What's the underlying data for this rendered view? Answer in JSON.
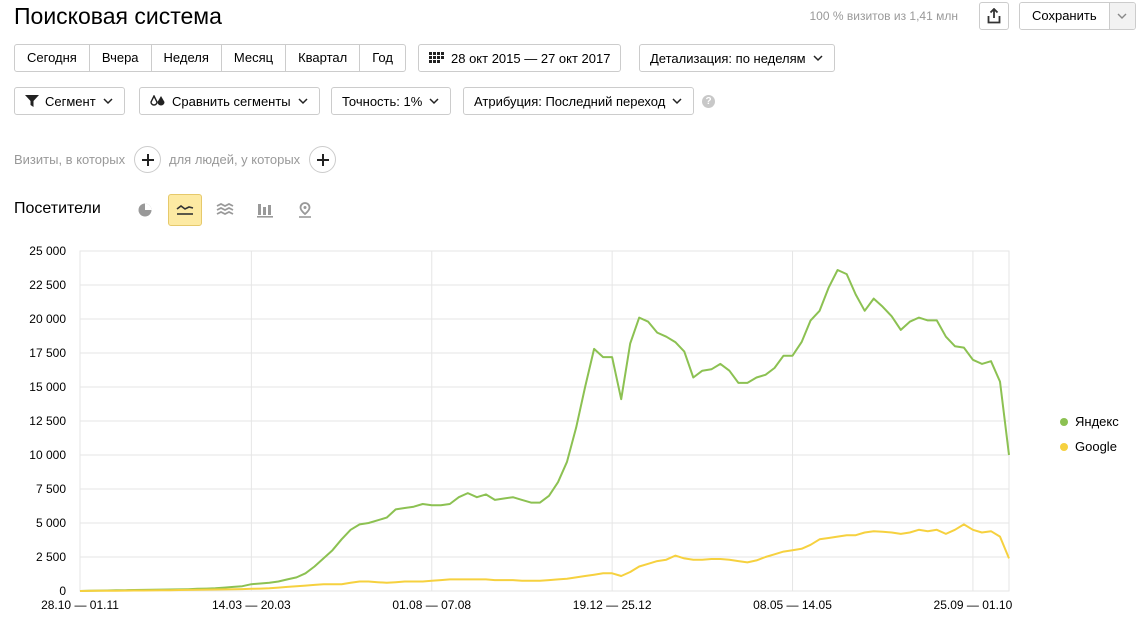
{
  "header": {
    "title": "Поисковая система",
    "visits_info": "100 % визитов из 1,41 млн",
    "save_label": "Сохранить"
  },
  "periods": [
    "Сегодня",
    "Вчера",
    "Неделя",
    "Месяц",
    "Квартал",
    "Год"
  ],
  "date_range": "28 окт 2015 — 27 окт 2017",
  "detail_label": "Детализация: по неделям",
  "segment_label": "Сегмент",
  "compare_label": "Сравнить сегменты",
  "accuracy_label": "Точность: 1%",
  "attribution_label": "Атрибуция: Последний переход",
  "help": "?",
  "filters": {
    "visits_label": "Визиты, в которых",
    "people_label": "для людей, у которых"
  },
  "metric_title": "Посетители",
  "colors": {
    "yandex": "#8cc152",
    "google": "#f6d13f",
    "grid": "#e6e6e6",
    "active_view": "#fdeaa3"
  },
  "chart_data": {
    "type": "line",
    "ylim": [
      0,
      25000
    ],
    "yticks": [
      "0",
      "2 500",
      "5 000",
      "7 500",
      "10 000",
      "12 500",
      "15 000",
      "17 500",
      "20 000",
      "22 500",
      "25 000"
    ],
    "xtick_labels": [
      "28.10 — 01.11",
      "14.03 — 20.03",
      "01.08 — 07.08",
      "19.12 — 25.12",
      "08.05 — 14.05",
      "25.09 — 01.10"
    ],
    "xtick_index": [
      0,
      19,
      39,
      59,
      79,
      99
    ],
    "series": [
      {
        "name": "Яндекс",
        "color": "#8cc152",
        "values": [
          0,
          20,
          30,
          40,
          50,
          60,
          70,
          80,
          90,
          100,
          110,
          120,
          130,
          160,
          180,
          200,
          250,
          300,
          350,
          500,
          550,
          600,
          700,
          850,
          1000,
          1300,
          1800,
          2400,
          3000,
          3800,
          4500,
          4900,
          5000,
          5200,
          5400,
          6000,
          6100,
          6200,
          6400,
          6300,
          6300,
          6400,
          6900,
          7200,
          6900,
          7100,
          6700,
          6800,
          6900,
          6700,
          6500,
          6500,
          7000,
          8000,
          9500,
          12000,
          15000,
          17800,
          17200,
          17200,
          14100,
          18200,
          20100,
          19800,
          19000,
          18700,
          18300,
          17600,
          15700,
          16200,
          16300,
          16700,
          16200,
          15300,
          15300,
          15700,
          15900,
          16400,
          17300,
          17300,
          18300,
          19900,
          20600,
          22300,
          23600,
          23300,
          21800,
          20600,
          21500,
          20900,
          20200,
          19200,
          19800,
          20100,
          19900,
          19900,
          18700,
          18000,
          17900,
          17000,
          16700,
          16900,
          15400,
          10000
        ]
      },
      {
        "name": "Google",
        "color": "#f6d13f",
        "values": [
          0,
          10,
          15,
          20,
          25,
          30,
          35,
          40,
          45,
          50,
          60,
          70,
          80,
          90,
          100,
          110,
          120,
          130,
          140,
          160,
          180,
          200,
          250,
          300,
          350,
          400,
          450,
          500,
          500,
          500,
          600,
          700,
          700,
          650,
          600,
          650,
          700,
          700,
          700,
          750,
          800,
          850,
          850,
          850,
          850,
          850,
          800,
          800,
          800,
          750,
          750,
          750,
          800,
          850,
          900,
          1000,
          1100,
          1200,
          1300,
          1300,
          1100,
          1400,
          1800,
          2000,
          2200,
          2300,
          2600,
          2400,
          2300,
          2300,
          2350,
          2350,
          2300,
          2200,
          2100,
          2250,
          2500,
          2700,
          2900,
          3000,
          3100,
          3400,
          3800,
          3900,
          4000,
          4100,
          4100,
          4300,
          4400,
          4350,
          4300,
          4200,
          4300,
          4500,
          4400,
          4500,
          4200,
          4500,
          4900,
          4500,
          4300,
          4400,
          4000,
          2400
        ]
      }
    ]
  }
}
